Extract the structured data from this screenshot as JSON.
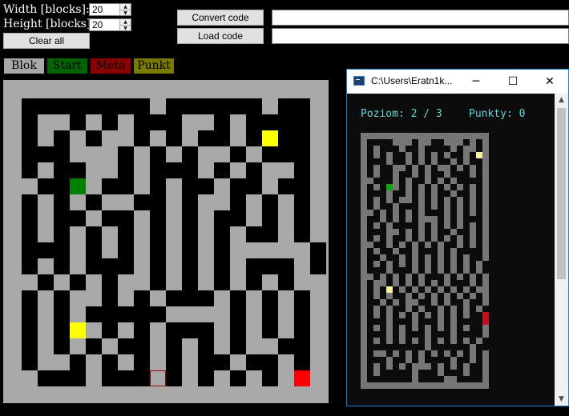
{
  "editor": {
    "width_label": "Width [blocks]:",
    "height_label": "Height [blocks]:",
    "width_value": "20",
    "height_value": "20",
    "clear_label": "Clear all",
    "convert_label": "Convert code",
    "load_label": "Load code",
    "convert_output": "",
    "load_input": ""
  },
  "tools": [
    {
      "label": "Blok",
      "bg": "#a8a8a8",
      "color": "#000000"
    },
    {
      "label": "Start",
      "bg": "#006400",
      "color": "#000000"
    },
    {
      "label": "Meta",
      "bg": "#8b0000",
      "color": "#000000"
    },
    {
      "label": "Punkt",
      "bg": "#7a7a00",
      "color": "#000000"
    }
  ],
  "colors": {
    "wall": "#a8a8a8",
    "path": "#000000",
    "start": "#008000",
    "meta": "#ff0000",
    "punkt": "#ffff00",
    "hover": "#a00000"
  },
  "maze": {
    "rows": [
      "####################",
      "#........#......#..#",
      "#.##.#.#...##.#....#",
      "#.#.#.##.#.#..#.P..#",
      "#...###.#.#.##.#...#",
      "#.#..##.#...#.#.##.#",
      "##..S#..#.#..#..#..#",
      "#.#.#.##..#.##.#.#.#",
      "#.#..#..#.#.#..#.#.#",
      "#.#.#.#.#.#.#.#..#.#",
      "#...#.#.#.#.#.#####.",
      "#.#.#...#.#.#.#...#.",
      "##.#.#.##.#.#.#.#.##",
      "#.#.##.#.#...#.#.#.#",
      "#.#.#.....####.#.#.#",
      "#.#.P#.#.#...#.#.#.#",
      "#.#.#.#..#.#.#.##..#",
      "#.##.#.#.#.#..#..#.#",
      "##...#...#.#.#.#.#M#",
      "####################"
    ],
    "hover_cell": [
      9,
      18
    ]
  },
  "console": {
    "title": "C:\\Users\\Eratn1k...",
    "level_text": "Poziom: 2 / 3",
    "points_text": "Punkty: 0",
    "minimize_icon": "─",
    "maximize_icon": "☐",
    "close_icon": "✕",
    "rows": [
      "####################",
      "#....###.##..###.#.#",
      "#.#...#..#....#.##.#",
      "#.#.#..#.#.#.#..#.P#",
      "#...#..#.#.#..#.#..#",
      "#.#..##.#.#.##.#.#.#",
      "#.#..#..#.#..#...#.#",
      "##...#.#..#.#.#....#",
      "#.#.S#.#.#.#.#.#.#.#",
      "#...#..#.#.#..#..#.#",
      "#.#.#.##.#.#.#.#.#.#",
      "#.#..#...#.#.#.#.#.#",
      "##.#.#.#.#...#.#.#.#",
      "#..#.#.#.###.#.#...#",
      "#.#.#....#.#.#.#.#.#",
      "#...##.#.#.#..#..#.#",
      "#.#.#..#.#.#.#.#.#.#",
      "##..#.#.#.#.#..#.#.#",
      "#.#..#..#...#.#....#",
      "#..#..#.#.#.#.#.#..#",
      "#.#.#.#.#.#.#.#.#.#.",
      "#...#...#.#.#.#.#.#.",
      "##.#.#.#.#...#.#.#.#",
      "#.##.#.#.#.#.#...#.#",
      "#.#.P.#.#.#.#.#.#.##",
      "#.#.#..#.#.#.#.#.#.#",
      "#..#.#.##..#.#..#..#",
      "#.#.#..#.#..#.#.#.#.",
      "#.#.#.#.#.#.#.#.#..M",
      "#...#...#...#.#....M",
      "#.#.#.#.#.#.#.#.#..#",
      "#...#.#...#...#....#",
      "#.#.#.#.#.#.#.#.#.#.",
      "#.........#......#..",
      "#.##.#.#.#.#.#.#.#.#",
      "#...#..#.#....#..#.#",
      "#.#.#.#.###.#.#.#..#",
      "#.#.....#...#...#..#",
      "#.......#....##....#",
      "####################"
    ],
    "colors": {
      "wall": "#767676",
      "path": "#0c0c0c",
      "start": "#13a10e",
      "meta": "#c50f1f",
      "punkt": "#f9f1a5"
    }
  }
}
